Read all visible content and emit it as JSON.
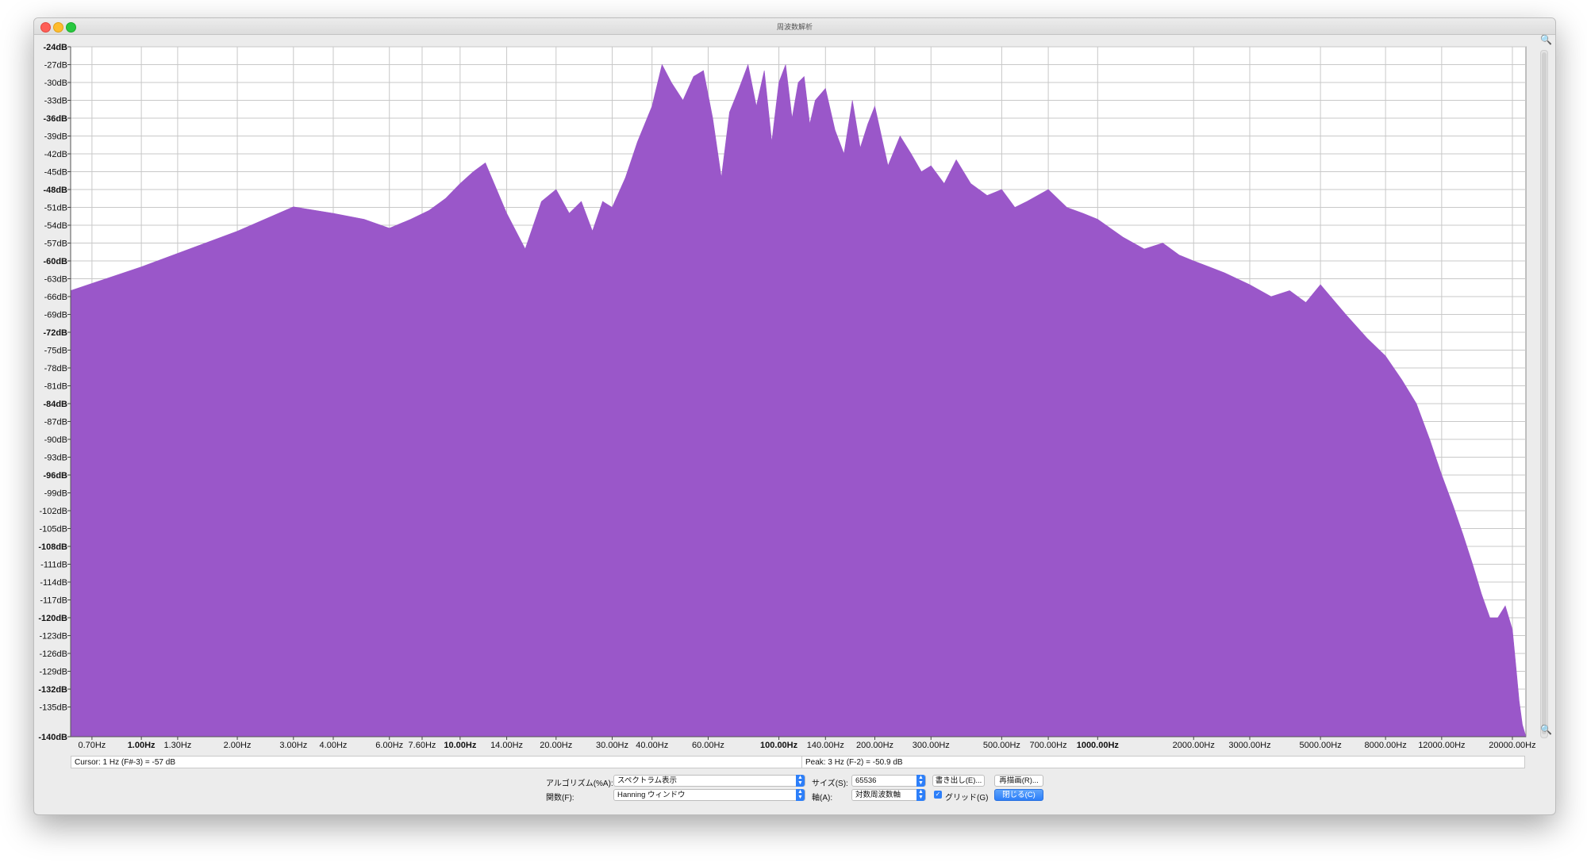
{
  "window": {
    "title": "周波数解析"
  },
  "chart_data": {
    "type": "area",
    "title": "",
    "x_scale": "log",
    "x_ticks": [
      {
        "v": 0.7,
        "label": "0.70Hz",
        "bold": false
      },
      {
        "v": 1,
        "label": "1.00Hz",
        "bold": true
      },
      {
        "v": 1.3,
        "label": "1.30Hz",
        "bold": false
      },
      {
        "v": 2,
        "label": "2.00Hz",
        "bold": false
      },
      {
        "v": 3,
        "label": "3.00Hz",
        "bold": false
      },
      {
        "v": 4,
        "label": "4.00Hz",
        "bold": false
      },
      {
        "v": 6,
        "label": "6.00Hz",
        "bold": false
      },
      {
        "v": 7.6,
        "label": "7.60Hz",
        "bold": false
      },
      {
        "v": 10,
        "label": "10.00Hz",
        "bold": true
      },
      {
        "v": 14,
        "label": "14.00Hz",
        "bold": false
      },
      {
        "v": 20,
        "label": "20.00Hz",
        "bold": false
      },
      {
        "v": 30,
        "label": "30.00Hz",
        "bold": false
      },
      {
        "v": 40,
        "label": "40.00Hz",
        "bold": false
      },
      {
        "v": 60,
        "label": "60.00Hz",
        "bold": false
      },
      {
        "v": 100,
        "label": "100.00Hz",
        "bold": true
      },
      {
        "v": 140,
        "label": "140.00Hz",
        "bold": false
      },
      {
        "v": 200,
        "label": "200.00Hz",
        "bold": false
      },
      {
        "v": 300,
        "label": "300.00Hz",
        "bold": false
      },
      {
        "v": 500,
        "label": "500.00Hz",
        "bold": false
      },
      {
        "v": 700,
        "label": "700.00Hz",
        "bold": false
      },
      {
        "v": 1000,
        "label": "1000.00Hz",
        "bold": true
      },
      {
        "v": 2000,
        "label": "2000.00Hz",
        "bold": false
      },
      {
        "v": 3000,
        "label": "3000.00Hz",
        "bold": false
      },
      {
        "v": 5000,
        "label": "5000.00Hz",
        "bold": false
      },
      {
        "v": 8000,
        "label": "8000.00Hz",
        "bold": false
      },
      {
        "v": 12000,
        "label": "12000.00Hz",
        "bold": false
      },
      {
        "v": 20000,
        "label": "20000.00Hz",
        "bold": false
      }
    ],
    "y_ticks": [
      {
        "v": -24,
        "label": "-24dB",
        "bold": true
      },
      {
        "v": -27,
        "label": "-27dB",
        "bold": false
      },
      {
        "v": -30,
        "label": "-30dB",
        "bold": false
      },
      {
        "v": -33,
        "label": "-33dB",
        "bold": false
      },
      {
        "v": -36,
        "label": "-36dB",
        "bold": true
      },
      {
        "v": -39,
        "label": "-39dB",
        "bold": false
      },
      {
        "v": -42,
        "label": "-42dB",
        "bold": false
      },
      {
        "v": -45,
        "label": "-45dB",
        "bold": false
      },
      {
        "v": -48,
        "label": "-48dB",
        "bold": true
      },
      {
        "v": -51,
        "label": "-51dB",
        "bold": false
      },
      {
        "v": -54,
        "label": "-54dB",
        "bold": false
      },
      {
        "v": -57,
        "label": "-57dB",
        "bold": false
      },
      {
        "v": -60,
        "label": "-60dB",
        "bold": true
      },
      {
        "v": -63,
        "label": "-63dB",
        "bold": false
      },
      {
        "v": -66,
        "label": "-66dB",
        "bold": false
      },
      {
        "v": -69,
        "label": "-69dB",
        "bold": false
      },
      {
        "v": -72,
        "label": "-72dB",
        "bold": true
      },
      {
        "v": -75,
        "label": "-75dB",
        "bold": false
      },
      {
        "v": -78,
        "label": "-78dB",
        "bold": false
      },
      {
        "v": -81,
        "label": "-81dB",
        "bold": false
      },
      {
        "v": -84,
        "label": "-84dB",
        "bold": true
      },
      {
        "v": -87,
        "label": "-87dB",
        "bold": false
      },
      {
        "v": -90,
        "label": "-90dB",
        "bold": false
      },
      {
        "v": -93,
        "label": "-93dB",
        "bold": false
      },
      {
        "v": -96,
        "label": "-96dB",
        "bold": true
      },
      {
        "v": -99,
        "label": "-99dB",
        "bold": false
      },
      {
        "v": -102,
        "label": "-102dB",
        "bold": false
      },
      {
        "v": -105,
        "label": "-105dB",
        "bold": false
      },
      {
        "v": -108,
        "label": "-108dB",
        "bold": true
      },
      {
        "v": -111,
        "label": "-111dB",
        "bold": false
      },
      {
        "v": -114,
        "label": "-114dB",
        "bold": false
      },
      {
        "v": -117,
        "label": "-117dB",
        "bold": false
      },
      {
        "v": -120,
        "label": "-120dB",
        "bold": true
      },
      {
        "v": -123,
        "label": "-123dB",
        "bold": false
      },
      {
        "v": -126,
        "label": "-126dB",
        "bold": false
      },
      {
        "v": -129,
        "label": "-129dB",
        "bold": false
      },
      {
        "v": -132,
        "label": "-132dB",
        "bold": true
      },
      {
        "v": -135,
        "label": "-135dB",
        "bold": false
      },
      {
        "v": -140,
        "label": "-140dB",
        "bold": true
      }
    ],
    "xlim": [
      0.6,
      22050
    ],
    "ylim": [
      -140,
      -24
    ],
    "grid": true,
    "fill_color": "#9a57c9",
    "series": [
      {
        "x": [
          0.6,
          1,
          2,
          3,
          4,
          5,
          6,
          7,
          8,
          9,
          10,
          11,
          12,
          14,
          16,
          18,
          20,
          22,
          24,
          26,
          28,
          30,
          33,
          36,
          40,
          43,
          46,
          50,
          54,
          58,
          62,
          66,
          70,
          75,
          80,
          85,
          90,
          95,
          100,
          105,
          110,
          115,
          120,
          125,
          130,
          140,
          150,
          160,
          170,
          180,
          190,
          200,
          220,
          240,
          260,
          280,
          300,
          330,
          360,
          400,
          450,
          500,
          550,
          600,
          700,
          800,
          900,
          1000,
          1200,
          1400,
          1600,
          1800,
          2000,
          2500,
          3000,
          3500,
          4000,
          4500,
          5000,
          6000,
          7000,
          8000,
          9000,
          10000,
          11000,
          12000,
          13000,
          14000,
          15000,
          16000,
          17000,
          18000,
          19000,
          20000,
          20500,
          21000,
          21500,
          22050
        ],
        "y": [
          -65,
          -61,
          -55,
          -50.9,
          -52,
          -53,
          -54.5,
          -53,
          -51.5,
          -49.5,
          -47,
          -45,
          -43.5,
          -52,
          -58,
          -50,
          -48,
          -52,
          -50,
          -55,
          -50,
          -51,
          -46,
          -40,
          -34,
          -27,
          -30,
          -33,
          -29,
          -28,
          -36,
          -46,
          -35,
          -31,
          -27,
          -34,
          -28,
          -40,
          -30,
          -27,
          -36,
          -30,
          -29,
          -37,
          -33,
          -31,
          -38,
          -42,
          -33,
          -41,
          -37,
          -34,
          -44,
          -39,
          -42,
          -45,
          -44,
          -47,
          -43,
          -47,
          -49,
          -48,
          -51,
          -50,
          -48,
          -51,
          -52,
          -53,
          -56,
          -58,
          -57,
          -59,
          -60,
          -62,
          -64,
          -66,
          -65,
          -67,
          -64,
          -69,
          -73,
          -76,
          -80,
          -84,
          -90,
          -96,
          -101,
          -106,
          -111,
          -116,
          -120,
          -120,
          -118,
          -122,
          -128,
          -134,
          -138,
          -140
        ]
      }
    ]
  },
  "status": {
    "cursor": "Cursor: 1 Hz (F#-3) = -57 dB",
    "peak": "Peak: 3 Hz (F-2) = -50.9 dB"
  },
  "controls": {
    "algorithm_label": "アルゴリズム(%A):",
    "algorithm_value": "スペクトラム表示",
    "function_label": "関数(F):",
    "function_value": "Hanning ウィンドウ",
    "size_label": "サイズ(S):",
    "size_value": "65536",
    "axis_label": "軸(A):",
    "axis_value": "対数周波数軸",
    "export_label": "書き出し(E)...",
    "replot_label": "再描画(R)...",
    "grid_label": "グリッド(G)",
    "close_label": "閉じる(C)"
  }
}
